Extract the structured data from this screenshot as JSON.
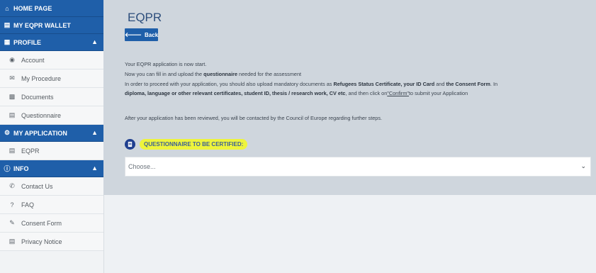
{
  "sidebar": {
    "home": "HOME PAGE",
    "wallet": "MY EQPR WALLET",
    "profile": {
      "title": "PROFILE",
      "items": [
        "Account",
        "My Procedure",
        "Documents",
        "Questionnaire"
      ]
    },
    "application": {
      "title": "MY APPLICATION",
      "items": [
        "EQPR"
      ]
    },
    "info": {
      "title": "INFO",
      "items": [
        "Contact Us",
        "FAQ",
        "Consent Form",
        "Privacy Notice"
      ]
    }
  },
  "main": {
    "title": "EQPR",
    "back_label": "Back",
    "para": {
      "l1": "Your EQPR application is now start.",
      "l2a": "Now you can fill in and upload the ",
      "l2b": "questionnaire",
      "l2c": " needed for the assessment",
      "l3a": "In order to proceed with your application, you should also upload mandatory documents as ",
      "l3b": "Refugees Status Certificate, your ID Card",
      "l3c": " and ",
      "l3d": "the Consent Form",
      "l3e": ". In",
      "l4a": "diploma, language or other relevant certificates, student ID, thesis / research work, CV etc",
      "l4b": ", and then click on",
      "l4c": "\"Confirm\"",
      "l4d": "to submit your Application",
      "l5": "After your application has been reviewed, you will be contacted by the Council of Europe regarding further steps."
    },
    "questionnaire_label": "QUESTIONNAIRE TO BE CERTIFIED:",
    "select_value": "Choose..."
  },
  "colors": {
    "brand": "#1f5fa9",
    "highlight": "#eef43c",
    "content_bg": "#cfd6dd"
  },
  "icons": {
    "home": "home-icon",
    "wallet": "wallet-icon",
    "profile": "id-card-icon",
    "account": "user-icon",
    "procedure": "envelope-icon",
    "documents": "file-icon",
    "questionnaire": "clipboard-icon",
    "application": "cogs-icon",
    "eqpr": "certificate-icon",
    "info": "info-icon",
    "contact": "phone-icon",
    "faq": "question-icon",
    "consent": "pen-icon",
    "privacy": "document-icon"
  }
}
